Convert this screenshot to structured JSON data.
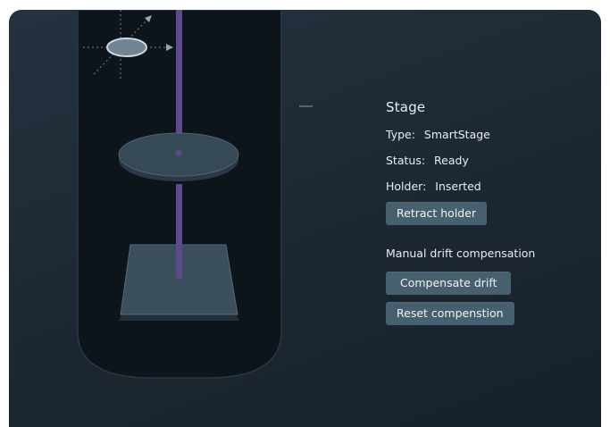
{
  "stage": {
    "title": "Stage",
    "type_label": "Type:",
    "type_value": "SmartStage",
    "status_label": "Status:",
    "status_value": "Ready",
    "holder_label": "Holder:",
    "holder_value": "Inserted",
    "retract_button": "Retract holder"
  },
  "drift": {
    "section_title": "Manual drift compensation",
    "compensate_button": "Compensate drift",
    "reset_button": "Reset compenstion"
  },
  "colors": {
    "background": "#1f2b35",
    "button": "#47606f",
    "rod": "#5b4a8c"
  }
}
